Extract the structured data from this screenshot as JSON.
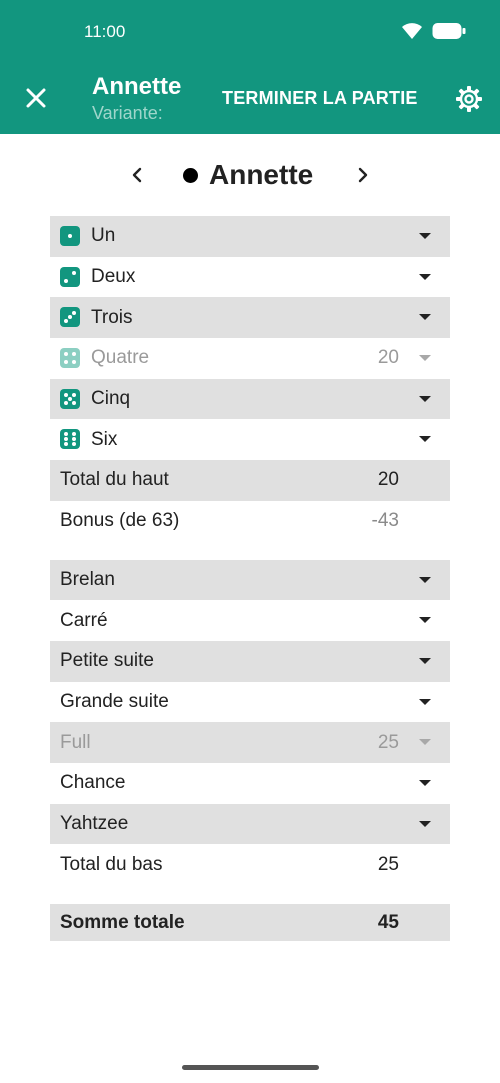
{
  "status": {
    "time": "11:00"
  },
  "appbar": {
    "title": "Annette",
    "subtitle": "Variante:",
    "end_label": "TERMINER LA PARTIE",
    "close_icon": "close-icon",
    "settings_icon": "gear-icon",
    "background": "#12967f"
  },
  "player": {
    "name": "Annette",
    "prev_icon": "chevron-left-icon",
    "next_icon": "chevron-right-icon"
  },
  "upper": [
    {
      "label": "Un",
      "value": "",
      "die": 1
    },
    {
      "label": "Deux",
      "value": "",
      "die": 2
    },
    {
      "label": "Trois",
      "value": "",
      "die": 3
    },
    {
      "label": "Quatre",
      "value": "20",
      "die": 4
    },
    {
      "label": "Cinq",
      "value": "",
      "die": 5
    },
    {
      "label": "Six",
      "value": "",
      "die": 6
    }
  ],
  "upper_total": {
    "label": "Total du haut",
    "value": "20"
  },
  "bonus": {
    "label": "Bonus (de 63)",
    "value": "-43"
  },
  "lower": [
    {
      "label": "Brelan",
      "value": ""
    },
    {
      "label": "Carré",
      "value": ""
    },
    {
      "label": "Petite suite",
      "value": ""
    },
    {
      "label": "Grande suite",
      "value": ""
    },
    {
      "label": "Full",
      "value": "25"
    },
    {
      "label": "Chance",
      "value": ""
    },
    {
      "label": "Yahtzee",
      "value": ""
    }
  ],
  "lower_total": {
    "label": "Total du bas",
    "value": "25"
  },
  "grand_total": {
    "label": "Somme totale",
    "value": "45"
  }
}
